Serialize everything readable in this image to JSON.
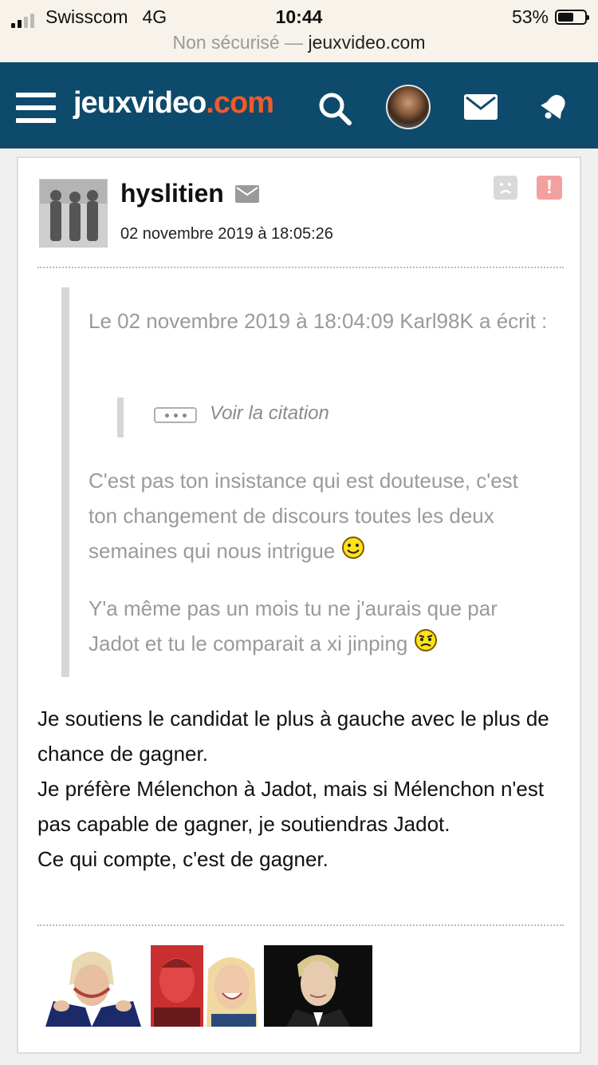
{
  "status_bar": {
    "carrier": "Swisscom",
    "network": "4G",
    "time": "10:44",
    "battery": "53%",
    "battery_level": 0.53
  },
  "url_bar": {
    "security": "Non sécurisé —",
    "domain": "jeuxvideo.com"
  },
  "header": {
    "logo_main": "jeuxvideo",
    "logo_suffix": ".com",
    "icons": [
      "menu-icon",
      "search-icon",
      "user-avatar",
      "mail-icon",
      "bell-icon"
    ],
    "colors": {
      "background": "#0e4a6b",
      "accent": "#f25a2a"
    }
  },
  "post": {
    "author": "hyslitien",
    "date": "02 novembre 2019 à 18:05:26",
    "quote": {
      "header": "Le 02 novembre 2019 à 18:04:09 Karl98K a écrit :",
      "see_quote": "Voir la citation",
      "paragraph1": "C'est pas ton insistance qui est douteuse, c'est ton changement de discours toutes les deux semaines qui nous intrigue",
      "paragraph2": "Y'a même pas un mois tu ne j'aurais que par Jadot et tu le comparait a xi jinping"
    },
    "body_lines": [
      "Je soutiens le candidat le plus à gauche avec le plus de chance de gagner.",
      "Je préfère Mélenchon à Jadot, mais si Mélenchon n'est pas capable de gagner, je soutiendras Jadot.",
      "Ce qui compte, c'est de gagner."
    ]
  }
}
